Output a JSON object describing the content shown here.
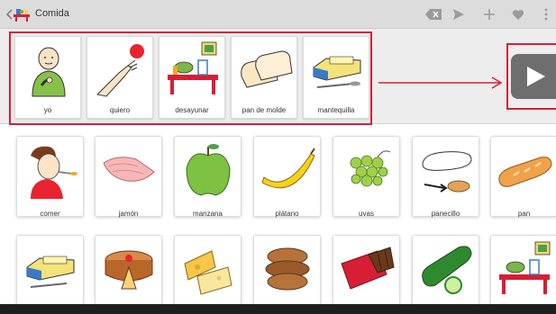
{
  "app": {
    "title": "Comida",
    "accent": "#d61f35"
  },
  "toolbar": {
    "icons": [
      "backspace-icon",
      "send-icon",
      "plus-icon",
      "heart-icon",
      "more-vert-icon"
    ]
  },
  "sentence": {
    "items": [
      {
        "label": "yo",
        "icon": "person-pointing-self-icon"
      },
      {
        "label": "quiero",
        "icon": "hand-reaching-ball-icon"
      },
      {
        "label": "desayunar",
        "icon": "breakfast-table-icon"
      },
      {
        "label": "pan de molde",
        "icon": "sliced-bread-icon"
      },
      {
        "label": "mantequilla",
        "icon": "butter-icon"
      }
    ],
    "play_icon": "play-icon"
  },
  "grid": {
    "row1": [
      {
        "label": "comer",
        "icon": "person-eating-icon"
      },
      {
        "label": "jamón",
        "icon": "ham-icon"
      },
      {
        "label": "manzana",
        "icon": "apple-icon"
      },
      {
        "label": "plátano",
        "icon": "banana-icon"
      },
      {
        "label": "uvas",
        "icon": "grapes-icon"
      },
      {
        "label": "panecillo",
        "icon": "bread-roll-icon"
      },
      {
        "label": "pan",
        "icon": "baguette-icon"
      }
    ],
    "row2": [
      {
        "label": "",
        "icon": "butter-icon"
      },
      {
        "label": "",
        "icon": "cake-icon"
      },
      {
        "label": "",
        "icon": "cheese-icon"
      },
      {
        "label": "",
        "icon": "cookies-icon"
      },
      {
        "label": "",
        "icon": "chocolate-icon"
      },
      {
        "label": "",
        "icon": "cucumber-icon"
      },
      {
        "label": "",
        "icon": "breakfast-table-icon"
      }
    ]
  }
}
